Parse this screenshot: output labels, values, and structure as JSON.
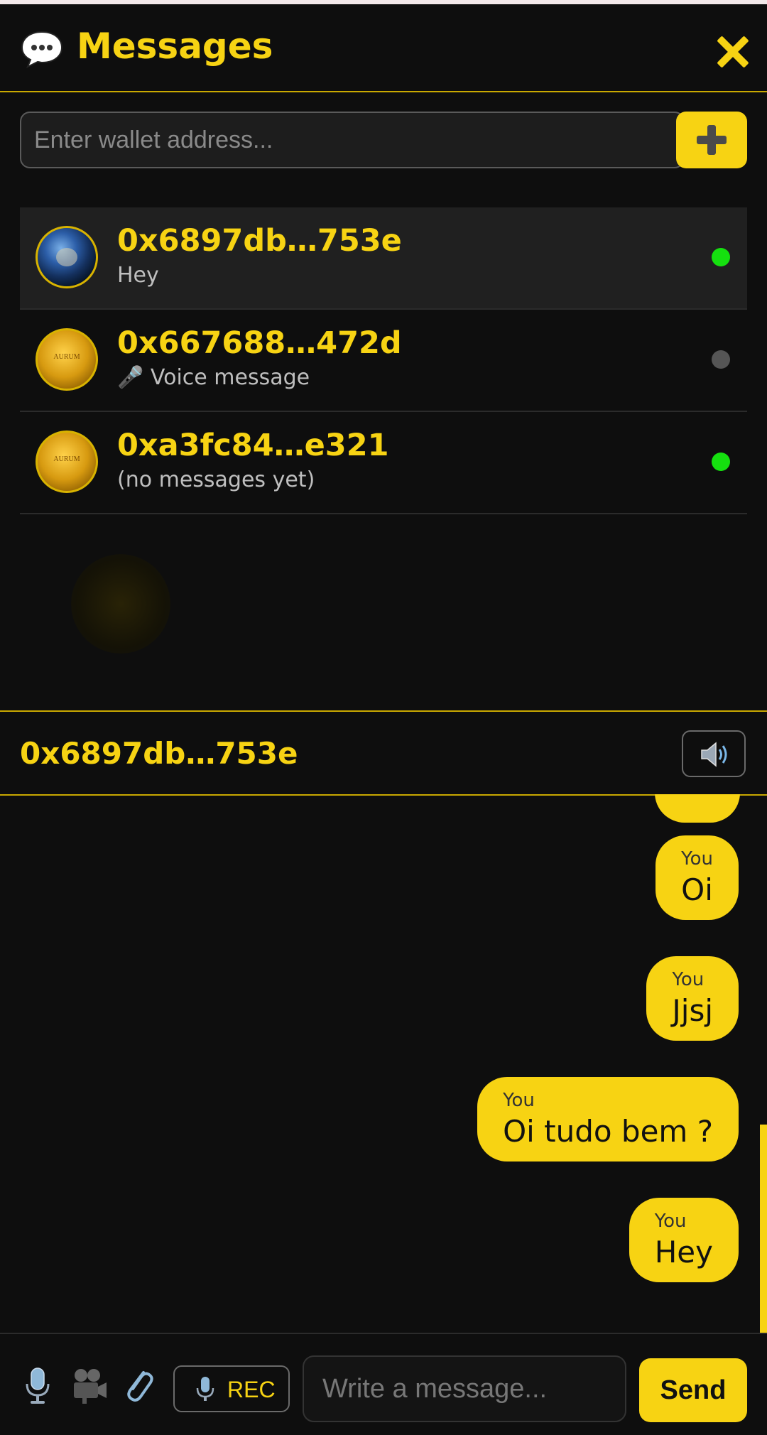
{
  "header": {
    "title": "Messages",
    "icon": "speech-bubble-icon",
    "close_icon": "close-icon"
  },
  "new_chat": {
    "placeholder": "Enter wallet address...",
    "add_icon": "plus-icon"
  },
  "conversations": [
    {
      "address": "0x6897db…753e",
      "preview": "Hey",
      "avatar": "earth-avatar",
      "online": true,
      "active": true
    },
    {
      "address": "0x667688…472d",
      "preview": "🎤 Voice message",
      "avatar": "aurum-coin-avatar",
      "coin_text": "AURUM",
      "online": false,
      "active": false
    },
    {
      "address": "0xa3fc84…e321",
      "preview": "(no messages yet)",
      "avatar": "aurum-coin-avatar",
      "coin_text": "AURUM",
      "online": true,
      "active": false
    }
  ],
  "chat": {
    "peer": "0x6897db…753e",
    "speaker_icon": "speaker-icon",
    "messages": [
      {
        "sender": "You",
        "text": "Oi"
      },
      {
        "sender": "You",
        "text": "Jjsj"
      },
      {
        "sender": "You",
        "text": "Oi tudo bem ?"
      },
      {
        "sender": "You",
        "text": "Hey"
      }
    ]
  },
  "composer": {
    "mic_icon": "microphone-icon",
    "video_icon": "video-camera-icon",
    "attach_icon": "paperclip-icon",
    "rec_label": "REC",
    "placeholder": "Write a message...",
    "send_label": "Send"
  },
  "colors": {
    "accent": "#f7d313",
    "background": "#0e0e0e",
    "online": "#15e00f",
    "offline": "#555555"
  }
}
